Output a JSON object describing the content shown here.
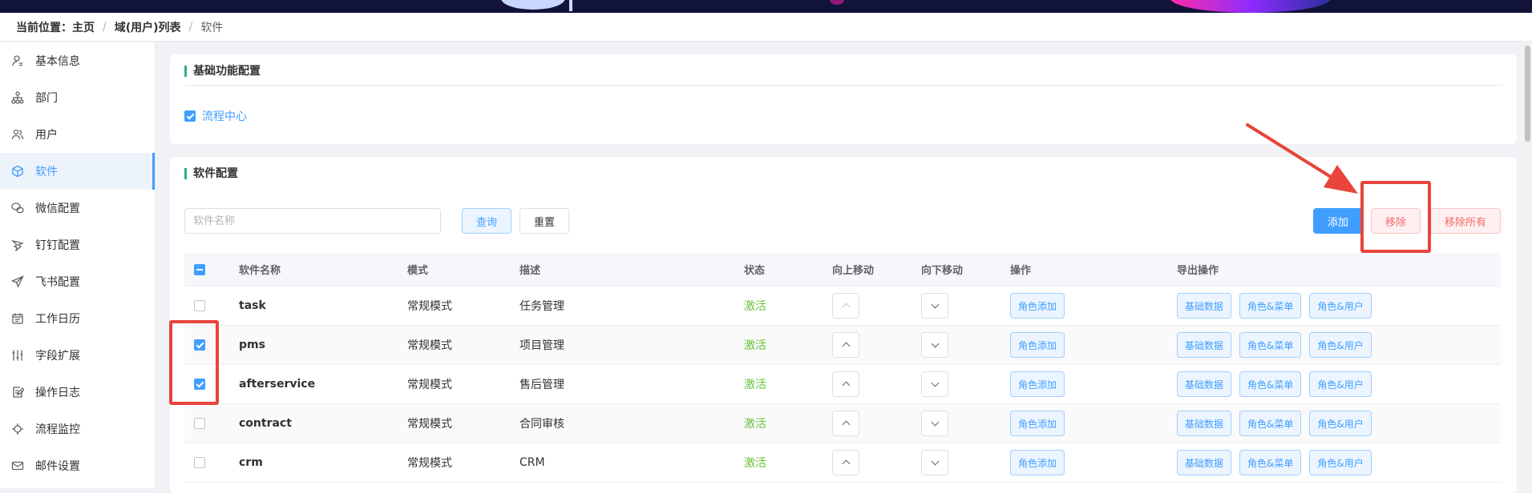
{
  "breadcrumb": {
    "prefix": "当前位置：",
    "items": [
      "主页",
      "域(用户)列表",
      "软件"
    ]
  },
  "sidebar": {
    "items": [
      {
        "label": "基本信息",
        "icon": "user-icon"
      },
      {
        "label": "部门",
        "icon": "org-tree-icon"
      },
      {
        "label": "用户",
        "icon": "users-icon"
      },
      {
        "label": "软件",
        "icon": "cube-icon",
        "active": true
      },
      {
        "label": "微信配置",
        "icon": "wechat-icon"
      },
      {
        "label": "钉钉配置",
        "icon": "dingtalk-icon"
      },
      {
        "label": "飞书配置",
        "icon": "send-icon"
      },
      {
        "label": "工作日历",
        "icon": "calendar-icon"
      },
      {
        "label": "字段扩展",
        "icon": "sliders-icon"
      },
      {
        "label": "操作日志",
        "icon": "log-edit-icon"
      },
      {
        "label": "流程监控",
        "icon": "monitor-icon"
      },
      {
        "label": "邮件设置",
        "icon": "mail-icon"
      }
    ]
  },
  "basic_config": {
    "title": "基础功能配置",
    "flow_center": {
      "label": "流程中心",
      "checked": true
    }
  },
  "software_config": {
    "title": "软件配置",
    "search": {
      "placeholder": "软件名称",
      "value": ""
    },
    "query_label": "查询",
    "reset_label": "重置",
    "add_label": "添加",
    "remove_label": "移除",
    "remove_all_label": "移除所有"
  },
  "table": {
    "columns": [
      "软件名称",
      "模式",
      "描述",
      "状态",
      "向上移动",
      "向下移动",
      "操作",
      "导出操作"
    ],
    "op_label": "角色添加",
    "export_labels": [
      "基础数据",
      "角色&菜单",
      "角色&用户"
    ],
    "rows": [
      {
        "name": "task",
        "mode": "常规模式",
        "desc": "任务管理",
        "status": "激活",
        "checked": false
      },
      {
        "name": "pms",
        "mode": "常规模式",
        "desc": "项目管理",
        "status": "激活",
        "checked": true
      },
      {
        "name": "afterservice",
        "mode": "常规模式",
        "desc": "售后管理",
        "status": "激活",
        "checked": true
      },
      {
        "name": "contract",
        "mode": "常规模式",
        "desc": "合同审核",
        "status": "激活",
        "checked": false
      },
      {
        "name": "crm",
        "mode": "常规模式",
        "desc": "CRM",
        "status": "激活",
        "checked": false
      }
    ]
  },
  "colors": {
    "accent": "#409eff",
    "status_active": "#67c23a",
    "danger": "#f56c6c",
    "annotation": "#e8443b",
    "title_bar": "#2ab37c"
  }
}
